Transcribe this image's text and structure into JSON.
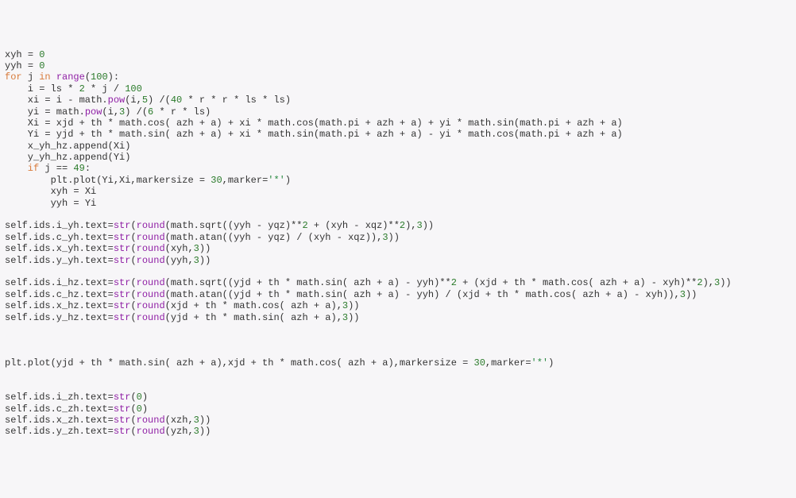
{
  "lines": [
    {
      "cls": "indent0",
      "fragments": [
        {
          "t": "xyh ",
          "c": "id"
        },
        {
          "t": "= ",
          "c": "op"
        },
        {
          "t": "0",
          "c": "num"
        }
      ]
    },
    {
      "cls": "indent0",
      "fragments": [
        {
          "t": "yyh ",
          "c": "id"
        },
        {
          "t": "= ",
          "c": "op"
        },
        {
          "t": "0",
          "c": "num"
        }
      ]
    },
    {
      "cls": "indent0",
      "fragments": [
        {
          "t": "for ",
          "c": "kw"
        },
        {
          "t": "j ",
          "c": "id"
        },
        {
          "t": "in ",
          "c": "kw"
        },
        {
          "t": "range",
          "c": "builtin"
        },
        {
          "t": "(",
          "c": "op"
        },
        {
          "t": "100",
          "c": "num"
        },
        {
          "t": "):",
          "c": "op"
        }
      ]
    },
    {
      "cls": "indent1",
      "fragments": [
        {
          "t": "i = ls * ",
          "c": "id"
        },
        {
          "t": "2",
          "c": "num"
        },
        {
          "t": " * j / ",
          "c": "id"
        },
        {
          "t": "100",
          "c": "num"
        }
      ]
    },
    {
      "cls": "indent1",
      "fragments": [
        {
          "t": "xi = i - math.",
          "c": "id"
        },
        {
          "t": "pow",
          "c": "builtin"
        },
        {
          "t": "(i,",
          "c": "id"
        },
        {
          "t": "5",
          "c": "num"
        },
        {
          "t": ") /(",
          "c": "id"
        },
        {
          "t": "40",
          "c": "num"
        },
        {
          "t": " * r * r * ls * ls)",
          "c": "id"
        }
      ]
    },
    {
      "cls": "indent1",
      "fragments": [
        {
          "t": "yi = math.",
          "c": "id"
        },
        {
          "t": "pow",
          "c": "builtin"
        },
        {
          "t": "(i,",
          "c": "id"
        },
        {
          "t": "3",
          "c": "num"
        },
        {
          "t": ") /(",
          "c": "id"
        },
        {
          "t": "6",
          "c": "num"
        },
        {
          "t": " * r * ls)",
          "c": "id"
        }
      ]
    },
    {
      "cls": "indent1",
      "fragments": [
        {
          "t": "Xi = xjd + th * math.cos( azh + a) + xi * math.cos(math.pi + azh + a) + yi * math.sin(math.pi + azh + a)",
          "c": "id"
        }
      ]
    },
    {
      "cls": "indent1",
      "fragments": [
        {
          "t": "Yi = yjd + th * math.sin( azh + a) + xi * math.sin(math.pi + azh + a) - yi * math.cos(math.pi + azh + a)",
          "c": "id"
        }
      ]
    },
    {
      "cls": "indent1",
      "fragments": [
        {
          "t": "x_yh_hz.append(Xi)",
          "c": "id"
        }
      ]
    },
    {
      "cls": "indent1",
      "fragments": [
        {
          "t": "y_yh_hz.append(Yi)",
          "c": "id"
        }
      ]
    },
    {
      "cls": "indent1",
      "fragments": [
        {
          "t": "if ",
          "c": "kw"
        },
        {
          "t": "j == ",
          "c": "id"
        },
        {
          "t": "49",
          "c": "num"
        },
        {
          "t": ":",
          "c": "op"
        }
      ]
    },
    {
      "cls": "indent2",
      "fragments": [
        {
          "t": "plt.plot(Yi,Xi,markersize = ",
          "c": "id"
        },
        {
          "t": "30",
          "c": "num"
        },
        {
          "t": ",marker=",
          "c": "id"
        },
        {
          "t": "'*'",
          "c": "str"
        },
        {
          "t": ")",
          "c": "id"
        }
      ]
    },
    {
      "cls": "indent2",
      "fragments": [
        {
          "t": "xyh = Xi",
          "c": "id"
        }
      ]
    },
    {
      "cls": "indent2",
      "fragments": [
        {
          "t": "yyh = Yi",
          "c": "id"
        }
      ]
    },
    {
      "cls": "indent0",
      "fragments": [
        {
          "t": " ",
          "c": "id"
        }
      ]
    },
    {
      "cls": "indent0",
      "fragments": [
        {
          "t": "self.ids.i_yh.text=",
          "c": "id"
        },
        {
          "t": "str",
          "c": "builtin"
        },
        {
          "t": "(",
          "c": "id"
        },
        {
          "t": "round",
          "c": "builtin"
        },
        {
          "t": "(math.sqrt((yyh - yqz)**",
          "c": "id"
        },
        {
          "t": "2",
          "c": "num"
        },
        {
          "t": " + (xyh - xqz)**",
          "c": "id"
        },
        {
          "t": "2",
          "c": "num"
        },
        {
          "t": "),",
          "c": "id"
        },
        {
          "t": "3",
          "c": "num"
        },
        {
          "t": "))",
          "c": "id"
        }
      ]
    },
    {
      "cls": "indent0",
      "fragments": [
        {
          "t": "self.ids.c_yh.text=",
          "c": "id"
        },
        {
          "t": "str",
          "c": "builtin"
        },
        {
          "t": "(",
          "c": "id"
        },
        {
          "t": "round",
          "c": "builtin"
        },
        {
          "t": "(math.atan((yyh - yqz) / (xyh - xqz)),",
          "c": "id"
        },
        {
          "t": "3",
          "c": "num"
        },
        {
          "t": "))",
          "c": "id"
        }
      ]
    },
    {
      "cls": "indent0",
      "fragments": [
        {
          "t": "self.ids.x_yh.text=",
          "c": "id"
        },
        {
          "t": "str",
          "c": "builtin"
        },
        {
          "t": "(",
          "c": "id"
        },
        {
          "t": "round",
          "c": "builtin"
        },
        {
          "t": "(xyh,",
          "c": "id"
        },
        {
          "t": "3",
          "c": "num"
        },
        {
          "t": "))",
          "c": "id"
        }
      ]
    },
    {
      "cls": "indent0",
      "fragments": [
        {
          "t": "self.ids.y_yh.text=",
          "c": "id"
        },
        {
          "t": "str",
          "c": "builtin"
        },
        {
          "t": "(",
          "c": "id"
        },
        {
          "t": "round",
          "c": "builtin"
        },
        {
          "t": "(yyh,",
          "c": "id"
        },
        {
          "t": "3",
          "c": "num"
        },
        {
          "t": "))",
          "c": "id"
        }
      ]
    },
    {
      "cls": "indent0",
      "fragments": [
        {
          "t": " ",
          "c": "id"
        }
      ]
    },
    {
      "cls": "indent0",
      "fragments": [
        {
          "t": "self.ids.i_hz.text=",
          "c": "id"
        },
        {
          "t": "str",
          "c": "builtin"
        },
        {
          "t": "(",
          "c": "id"
        },
        {
          "t": "round",
          "c": "builtin"
        },
        {
          "t": "(math.sqrt((yjd + th * math.sin( azh + a) - yyh)**",
          "c": "id"
        },
        {
          "t": "2",
          "c": "num"
        },
        {
          "t": " + (xjd + th * math.cos( azh + a) - xyh)**",
          "c": "id"
        },
        {
          "t": "2",
          "c": "num"
        },
        {
          "t": "),",
          "c": "id"
        },
        {
          "t": "3",
          "c": "num"
        },
        {
          "t": "))",
          "c": "id"
        }
      ]
    },
    {
      "cls": "indent0",
      "fragments": [
        {
          "t": "self.ids.c_hz.text=",
          "c": "id"
        },
        {
          "t": "str",
          "c": "builtin"
        },
        {
          "t": "(",
          "c": "id"
        },
        {
          "t": "round",
          "c": "builtin"
        },
        {
          "t": "(math.atan((yjd + th * math.sin( azh + a) - yyh) / (xjd + th * math.cos( azh + a) - xyh)),",
          "c": "id"
        },
        {
          "t": "3",
          "c": "num"
        },
        {
          "t": "))",
          "c": "id"
        }
      ]
    },
    {
      "cls": "indent0",
      "fragments": [
        {
          "t": "self.ids.x_hz.text=",
          "c": "id"
        },
        {
          "t": "str",
          "c": "builtin"
        },
        {
          "t": "(",
          "c": "id"
        },
        {
          "t": "round",
          "c": "builtin"
        },
        {
          "t": "(xjd + th * math.cos( azh + a),",
          "c": "id"
        },
        {
          "t": "3",
          "c": "num"
        },
        {
          "t": "))",
          "c": "id"
        }
      ]
    },
    {
      "cls": "indent0",
      "fragments": [
        {
          "t": "self.ids.y_hz.text=",
          "c": "id"
        },
        {
          "t": "str",
          "c": "builtin"
        },
        {
          "t": "(",
          "c": "id"
        },
        {
          "t": "round",
          "c": "builtin"
        },
        {
          "t": "(yjd + th * math.sin( azh + a),",
          "c": "id"
        },
        {
          "t": "3",
          "c": "num"
        },
        {
          "t": "))",
          "c": "id"
        }
      ]
    },
    {
      "cls": "indent0",
      "fragments": [
        {
          "t": " ",
          "c": "id"
        }
      ]
    },
    {
      "cls": "indent0",
      "fragments": [
        {
          "t": " ",
          "c": "id"
        }
      ]
    },
    {
      "cls": "indent0",
      "fragments": [
        {
          "t": " ",
          "c": "id"
        }
      ]
    },
    {
      "cls": "indent0",
      "fragments": [
        {
          "t": "plt.plot(yjd + th * math.sin( azh + a),xjd + th * math.cos( azh + a),markersize = ",
          "c": "id"
        },
        {
          "t": "30",
          "c": "num"
        },
        {
          "t": ",marker=",
          "c": "id"
        },
        {
          "t": "'*'",
          "c": "str"
        },
        {
          "t": ")",
          "c": "id"
        }
      ]
    },
    {
      "cls": "indent0",
      "fragments": [
        {
          "t": " ",
          "c": "id"
        }
      ]
    },
    {
      "cls": "indent0",
      "fragments": [
        {
          "t": " ",
          "c": "id"
        }
      ]
    },
    {
      "cls": "indent0",
      "fragments": [
        {
          "t": "self.ids.i_zh.text=",
          "c": "id"
        },
        {
          "t": "str",
          "c": "builtin"
        },
        {
          "t": "(",
          "c": "id"
        },
        {
          "t": "0",
          "c": "num"
        },
        {
          "t": ")",
          "c": "id"
        }
      ]
    },
    {
      "cls": "indent0",
      "fragments": [
        {
          "t": "self.ids.c_zh.text=",
          "c": "id"
        },
        {
          "t": "str",
          "c": "builtin"
        },
        {
          "t": "(",
          "c": "id"
        },
        {
          "t": "0",
          "c": "num"
        },
        {
          "t": ")",
          "c": "id"
        }
      ]
    },
    {
      "cls": "indent0",
      "fragments": [
        {
          "t": "self.ids.x_zh.text=",
          "c": "id"
        },
        {
          "t": "str",
          "c": "builtin"
        },
        {
          "t": "(",
          "c": "id"
        },
        {
          "t": "round",
          "c": "builtin"
        },
        {
          "t": "(xzh,",
          "c": "id"
        },
        {
          "t": "3",
          "c": "num"
        },
        {
          "t": "))",
          "c": "id"
        }
      ]
    },
    {
      "cls": "indent0",
      "fragments": [
        {
          "t": "self.ids.y_zh.text=",
          "c": "id"
        },
        {
          "t": "str",
          "c": "builtin"
        },
        {
          "t": "(",
          "c": "id"
        },
        {
          "t": "round",
          "c": "builtin"
        },
        {
          "t": "(yzh,",
          "c": "id"
        },
        {
          "t": "3",
          "c": "num"
        },
        {
          "t": "))",
          "c": "id"
        }
      ]
    }
  ]
}
